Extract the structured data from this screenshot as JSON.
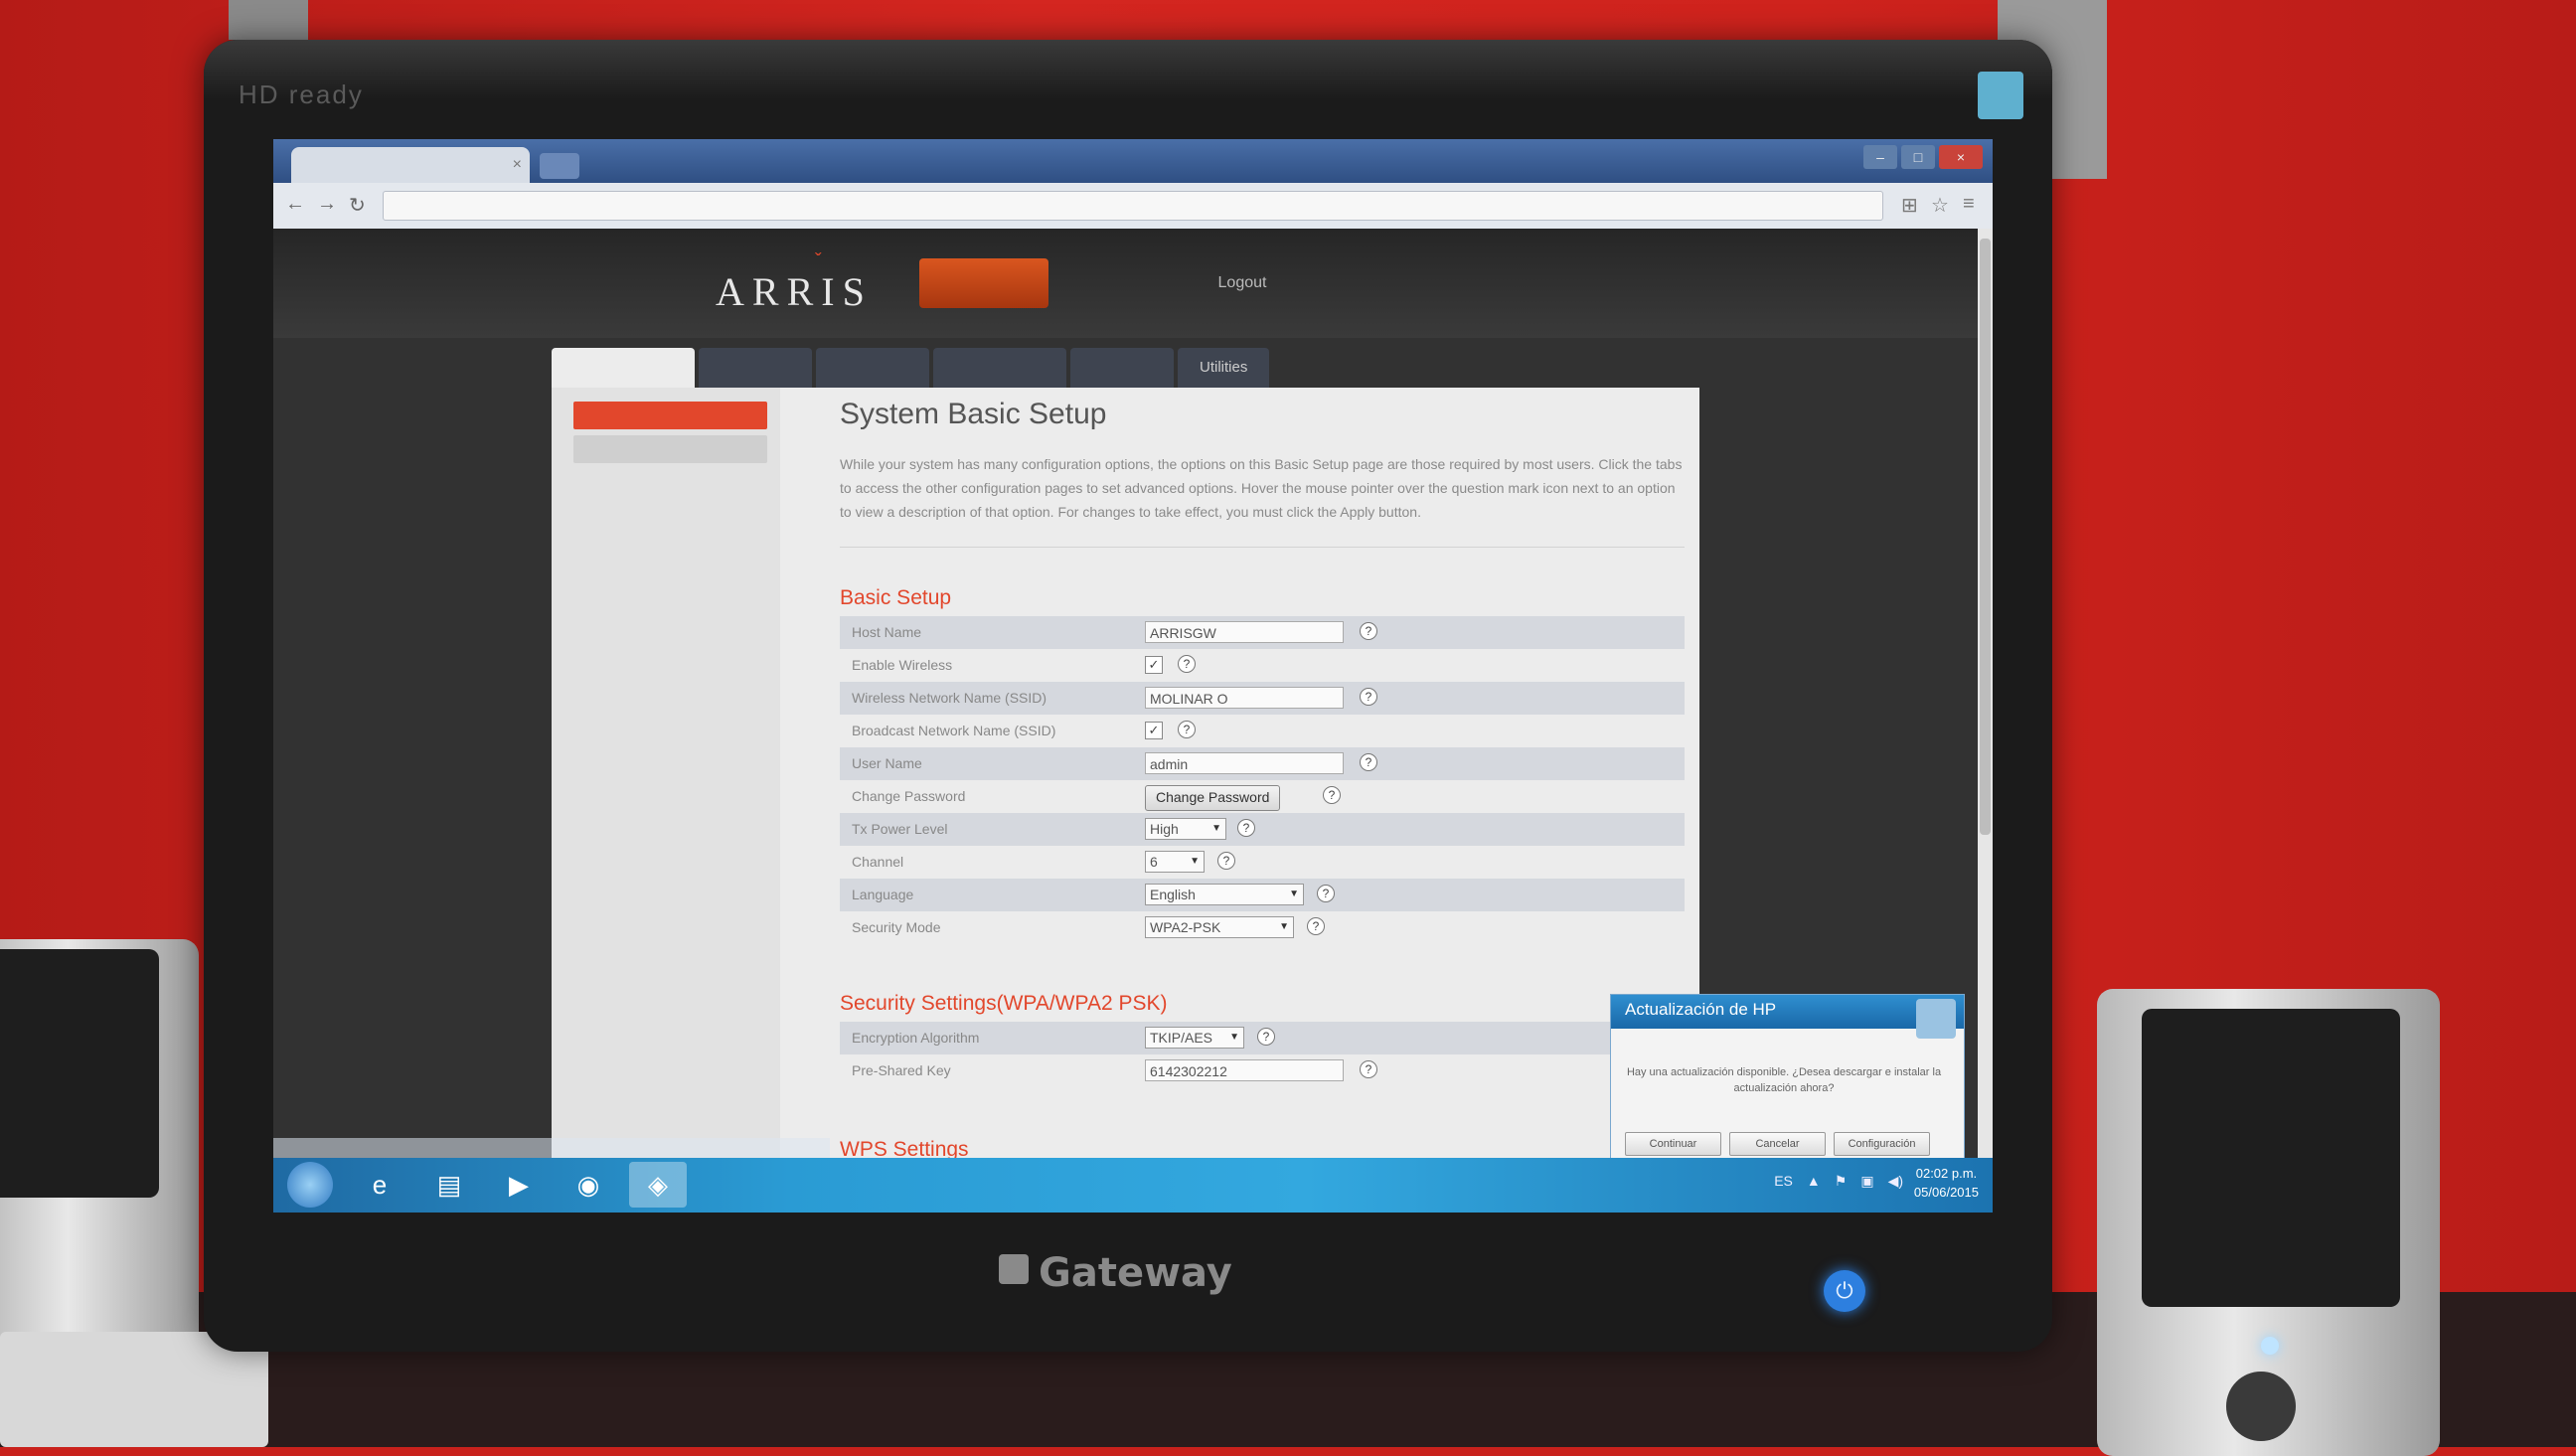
{
  "monitor": {
    "badge": "HD ready",
    "brand": "Gateway",
    "power_icon": "power-icon"
  },
  "browser": {
    "tab_title": "",
    "tab_close": "×",
    "url": "",
    "controls": {
      "minimize": "–",
      "maximize": "□",
      "close": "×"
    },
    "nav": {
      "back": "←",
      "forward": "→",
      "reload": "↻"
    },
    "icons": {
      "extension": "⊞",
      "star": "☆",
      "menu": "≡"
    }
  },
  "router": {
    "logo": "ARRIS",
    "logo_mark": "ˇ",
    "top_nav": [
      "",
      "",
      "Logout"
    ],
    "sub_nav": [
      "",
      "",
      "",
      "",
      "",
      "Utilities"
    ],
    "sidebar": [
      "",
      ""
    ],
    "title": "System Basic Setup",
    "intro": "While your system has many configuration options, the options on this Basic Setup page are those required by most users. Click the tabs to access the other configuration pages to set advanced options. Hover the mouse pointer over the question mark icon next to an option to view a description of that option. For changes to take effect, you must click the Apply button.",
    "help_glyph": "?",
    "check_glyph": "✓",
    "select_arrow": "▼",
    "basic_setup": {
      "heading": "Basic Setup",
      "host_name": {
        "label": "Host Name",
        "value": "ARRISGW"
      },
      "enable_wireless": {
        "label": "Enable Wireless",
        "checked": true
      },
      "ssid": {
        "label": "Wireless Network Name (SSID)",
        "value": "MOLINAR O"
      },
      "broadcast_ssid": {
        "label": "Broadcast Network Name (SSID)",
        "checked": true
      },
      "user_name": {
        "label": "User Name",
        "value": "admin"
      },
      "change_password": {
        "label": "Change Password",
        "button": "Change Password"
      },
      "tx_power": {
        "label": "Tx Power Level",
        "value": "High"
      },
      "channel": {
        "label": "Channel",
        "value": "6"
      },
      "language": {
        "label": "Language",
        "value": "English"
      },
      "security_mode": {
        "label": "Security Mode",
        "value": "WPA2-PSK"
      }
    },
    "security_settings": {
      "heading": "Security Settings(WPA/WPA2 PSK)",
      "encryption": {
        "label": "Encryption Algorithm",
        "value": "TKIP/AES"
      },
      "psk": {
        "label": "Pre-Shared Key",
        "value": "6142302212"
      }
    },
    "wps_heading": "WPS Settings"
  },
  "hp_popup": {
    "title": "Actualización de HP",
    "message": "Hay una actualización disponible. ¿Desea descargar e instalar la actualización ahora?",
    "buttons": [
      "Continuar",
      "Cancelar",
      "Configuración"
    ]
  },
  "taskbar": {
    "apps": [
      "e",
      "▤",
      "▶",
      "◉",
      "◈"
    ],
    "tray": [
      "ES",
      "▲",
      "⚑",
      "▣",
      "◀)"
    ],
    "time": "02:02 p.m.",
    "date": "05/06/2015"
  },
  "colors": {
    "accent": "#e2472c",
    "wall": "#c9211c",
    "taskbar": "#2a9bd4"
  }
}
